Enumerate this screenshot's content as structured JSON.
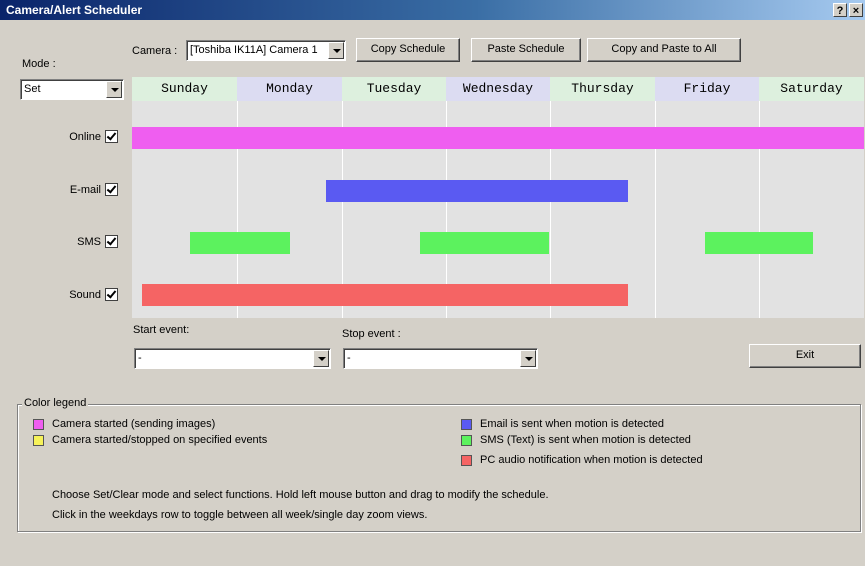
{
  "window": {
    "title": "Camera/Alert Scheduler",
    "help": "?",
    "close": "×"
  },
  "mode": {
    "label": "Mode :",
    "value": "Set"
  },
  "camera": {
    "label": "Camera :",
    "value": "[Toshiba IK11A] Camera 1"
  },
  "toolbar": {
    "copy_schedule": "Copy Schedule",
    "paste_schedule": "Paste Schedule",
    "copy_paste_all": "Copy and Paste to All"
  },
  "days": [
    "Sunday",
    "Monday",
    "Tuesday",
    "Wednesday",
    "Thursday",
    "Friday",
    "Saturday"
  ],
  "rows": [
    {
      "label": "Online",
      "checked": true
    },
    {
      "label": "E-mail",
      "checked": true
    },
    {
      "label": "SMS",
      "checked": true
    },
    {
      "label": "Sound",
      "checked": true
    }
  ],
  "colors": {
    "online": "#ef5ef0",
    "email": "#5a5af2",
    "sms": "#5cf25e",
    "sound": "#f56464",
    "event": "#f6f25a",
    "day_header_a": "#ddf0de",
    "day_header_b": "#dcdcf2",
    "grid_bg": "#e2e2e2"
  },
  "events": {
    "start_label": "Start event:",
    "start_value": "-",
    "stop_label": "Stop event :",
    "stop_value": "-"
  },
  "exit_label": "Exit",
  "legend": {
    "title": "Color legend",
    "items": [
      "Camera started (sending images)",
      "Camera started/stopped on specified events",
      "Email is sent when motion is detected",
      "SMS (Text) is sent when motion is detected",
      "PC audio notification when motion is detected"
    ]
  },
  "instructions": [
    "Choose Set/Clear mode and select functions. Hold left mouse button and drag to modify the schedule.",
    "Click in the weekdays row to toggle between all week/single day zoom views."
  ]
}
